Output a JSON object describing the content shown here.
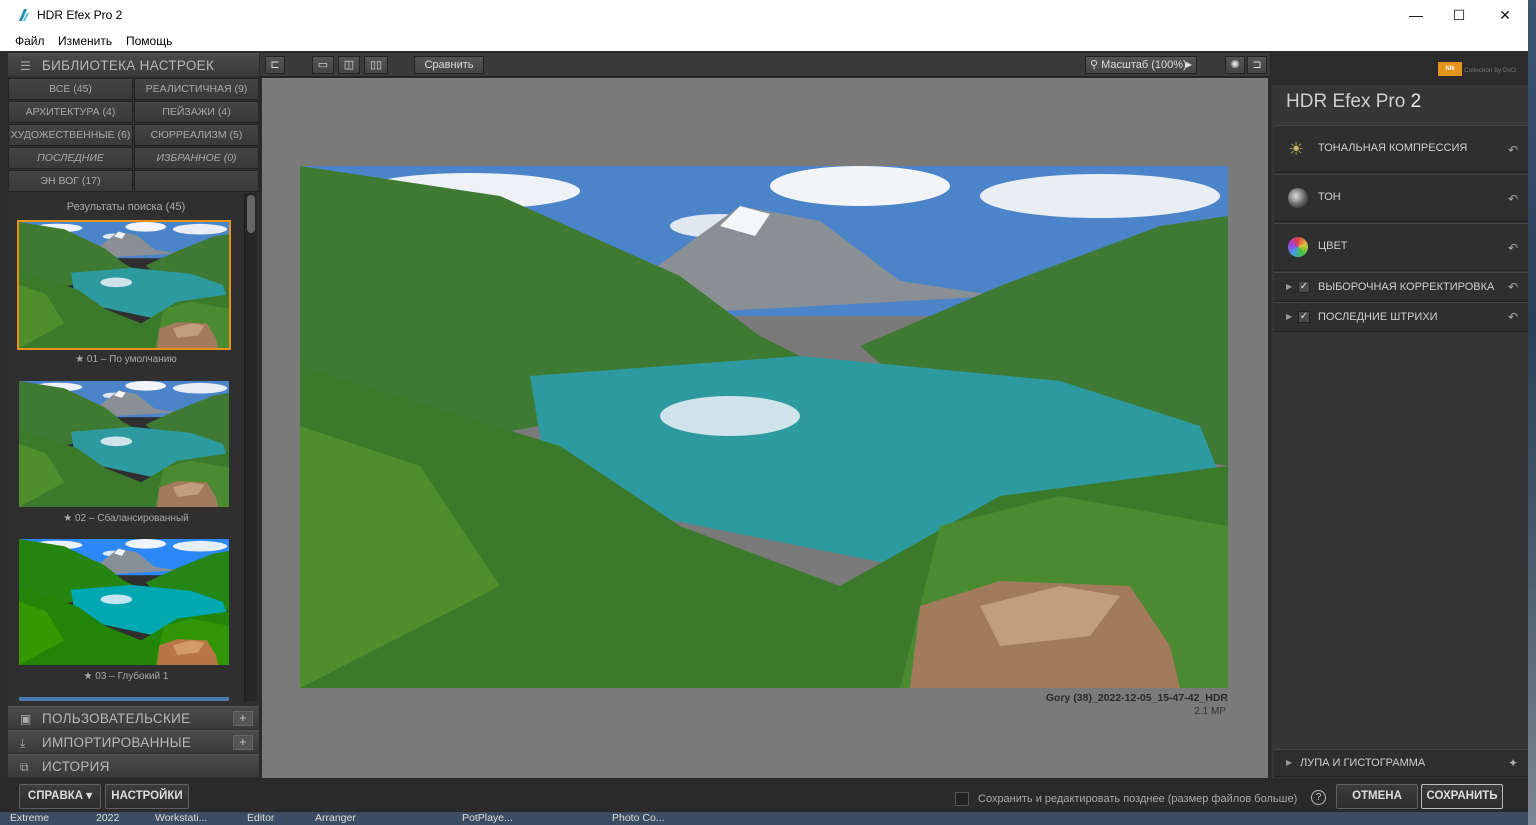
{
  "window": {
    "title": "HDR Efex Pro 2",
    "minimize": "—",
    "maximize": "☐",
    "close": "✕"
  },
  "menu": [
    "Файл",
    "Изменить",
    "Помощь"
  ],
  "library": {
    "header": "БИБЛИОТЕКА НАСТРОЕК",
    "filters": [
      "ВСЕ (45)",
      "РЕАЛИСТИЧНАЯ (9)",
      "АРХИТЕКТУРА (4)",
      "ПЕЙЗАЖИ (4)",
      "ХУДОЖЕСТВЕННЫЕ (6)",
      "СЮРРЕАЛИЗМ (5)",
      "ПОСЛЕДНИЕ",
      "ИЗБРАННОЕ (0)",
      "ЭН ВОГ (17)"
    ],
    "results_label": "Результаты поиска (45)",
    "presets": [
      "★ 01 – По умолчанию",
      "★ 02 – Сбалансированный",
      "★ 03 – Глубокий 1"
    ],
    "sections": [
      {
        "label": "ПОЛЬЗОВАТЕЛЬСКИЕ",
        "plus": "+"
      },
      {
        "label": "ИМПОРТИРОВАННЫЕ",
        "plus": "+"
      },
      {
        "label": "ИСТОРИЯ"
      }
    ]
  },
  "toolbar": {
    "compare": "Сравнить",
    "zoom": "Масштаб (100%)"
  },
  "image": {
    "filename": "Gory (38)_2022-12-05_15-47-42_HDR",
    "size": "2.1 MP"
  },
  "right_panel": {
    "brand": "Nik",
    "brand_sub": "Collection by DxO",
    "app_name": "HDR Efex Pro",
    "app_version": "2",
    "sections": [
      "ТОНАЛЬНАЯ КОМПРЕССИЯ",
      "ТОН",
      "ЦВЕТ",
      "ВЫБОРОЧНАЯ КОРРЕКТИРОВКА",
      "ПОСЛЕДНИЕ ШТРИХИ"
    ],
    "loupe": "ЛУПА И ГИСТОГРАММА"
  },
  "bottom": {
    "help": "СПРАВКА ▾",
    "settings": "НАСТРОЙКИ",
    "save_later": "Сохранить и редактировать позднее (размер файлов больше)",
    "cancel": "ОТМЕНА",
    "save": "СОХРАНИТЬ"
  },
  "taskbar": [
    "Extreme",
    "2022",
    "Workstati...",
    "Editor",
    "Arranger",
    "PotPlaye...",
    "Photo Co..."
  ],
  "colors": {
    "accent": "#e6931e",
    "panel": "#2f2f2f",
    "canvas": "#7a7a7a"
  }
}
